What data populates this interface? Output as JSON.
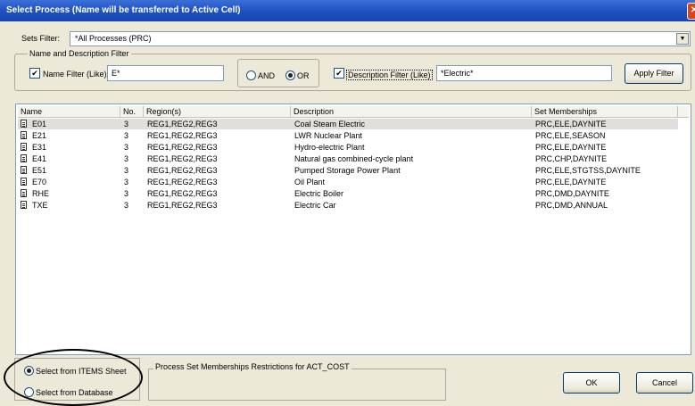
{
  "window": {
    "title": "Select Process (Name will be transferred to Active Cell)"
  },
  "sets_filter": {
    "label": "Sets Filter:",
    "value": "*All Processes (PRC)"
  },
  "name_desc_filter": {
    "legend": "Name and Description Filter",
    "name_filter_label": "Name Filter (Like)",
    "name_filter_value": "E*",
    "name_filter_checked": true,
    "and_label": "AND",
    "or_label": "OR",
    "selected_logic": "OR",
    "desc_filter_label": "Description Filter (Like)",
    "desc_filter_value": "*Electric*",
    "desc_filter_checked": true,
    "apply_label": "Apply Filter"
  },
  "table": {
    "headers": {
      "name": "Name",
      "no": "No.",
      "regions": "Region(s)",
      "description": "Description",
      "sets": "Set Memberships"
    },
    "rows": [
      {
        "name": "E01",
        "no": "3",
        "regions": "REG1,REG2,REG3",
        "description": "Coal Steam Electric",
        "sets": "PRC,ELE,DAYNITE"
      },
      {
        "name": "E21",
        "no": "3",
        "regions": "REG1,REG2,REG3",
        "description": "LWR Nuclear Plant",
        "sets": "PRC,ELE,SEASON"
      },
      {
        "name": "E31",
        "no": "3",
        "regions": "REG1,REG2,REG3",
        "description": "Hydro-electric Plant",
        "sets": "PRC,ELE,DAYNITE"
      },
      {
        "name": "E41",
        "no": "3",
        "regions": "REG1,REG2,REG3",
        "description": "Natural gas combined-cycle plant",
        "sets": "PRC,CHP,DAYNITE"
      },
      {
        "name": "E51",
        "no": "3",
        "regions": "REG1,REG2,REG3",
        "description": "Pumped Storage Power Plant",
        "sets": "PRC,ELE,STGTSS,DAYNITE"
      },
      {
        "name": "E70",
        "no": "3",
        "regions": "REG1,REG2,REG3",
        "description": "Oil Plant",
        "sets": "PRC,ELE,DAYNITE"
      },
      {
        "name": "RHE",
        "no": "3",
        "regions": "REG1,REG2,REG3",
        "description": "Electric Boiler",
        "sets": "PRC,DMD,DAYNITE"
      },
      {
        "name": "TXE",
        "no": "3",
        "regions": "REG1,REG2,REG3",
        "description": "Electric Car",
        "sets": "PRC,DMD,ANNUAL"
      }
    ]
  },
  "source": {
    "items_label": "Select from ITEMS Sheet",
    "db_label": "Select from Database",
    "selected": "items"
  },
  "restrictions": {
    "legend": "Process Set Memberships Restrictions for ACT_COST"
  },
  "buttons": {
    "ok": "OK",
    "cancel": "Cancel"
  },
  "colors": {
    "title_bar": "#1c4fc0",
    "dialog_bg": "#ece9d8",
    "selected_row": "#e0dfdb"
  }
}
